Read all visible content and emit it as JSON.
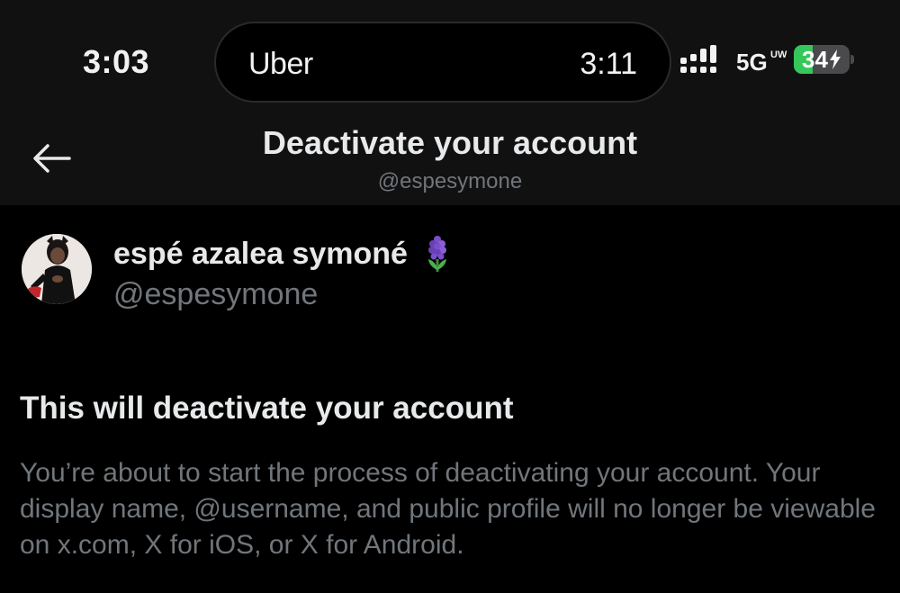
{
  "status_bar": {
    "time": "3:03",
    "live_activity": {
      "app": "Uber",
      "time": "3:11"
    },
    "network": "5G",
    "network_sub": "UW",
    "battery": "34",
    "battery_level": 0.34,
    "battery_color": "#34c759"
  },
  "header": {
    "back_icon": "back-arrow-icon",
    "title": "Deactivate your account",
    "handle": "@espesymone"
  },
  "profile": {
    "name": "espé azalea symoné",
    "handle": "@espesymone",
    "emoji": "hyacinth-emoji"
  },
  "content": {
    "title": "This will deactivate your account",
    "body": "You’re about to start the process of deactivating your account. Your display name, @username, and public profile will no longer be viewable on x.com, X for iOS, or X for Android."
  }
}
